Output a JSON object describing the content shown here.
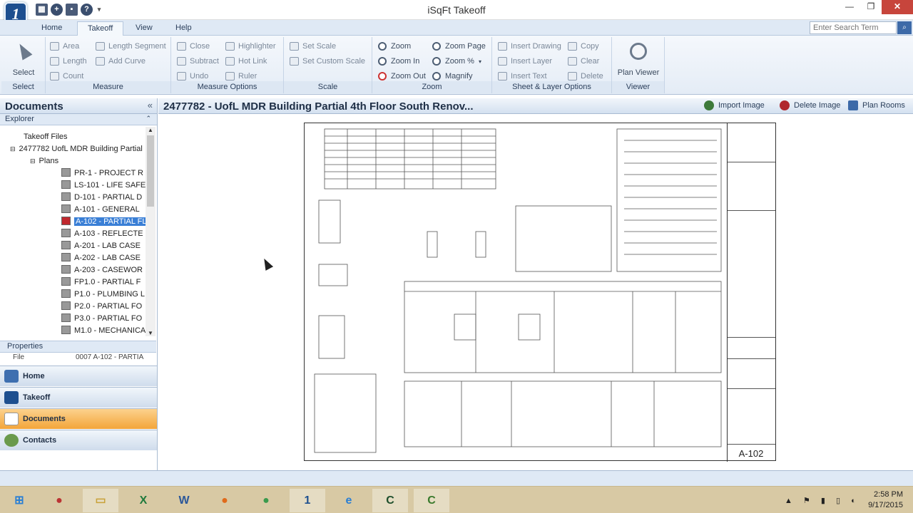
{
  "window": {
    "title": "iSqFt Takeoff",
    "logo": "1"
  },
  "ribbon_tabs": [
    "Home",
    "Takeoff",
    "View",
    "Help"
  ],
  "search": {
    "placeholder": "Enter Search Term"
  },
  "ribbon": {
    "select": {
      "label": "Select",
      "group": "Select"
    },
    "measure": {
      "group": "Measure",
      "area": "Area",
      "length": "Length",
      "count": "Count",
      "length_segment": "Length Segment",
      "add_curve": "Add Curve"
    },
    "measure_options": {
      "group": "Measure Options",
      "close": "Close",
      "subtract": "Subtract",
      "undo": "Undo",
      "highlighter": "Highlighter",
      "hot_link": "Hot Link",
      "ruler": "Ruler"
    },
    "scale": {
      "group": "Scale",
      "set_scale": "Set Scale",
      "set_custom_scale": "Set Custom Scale"
    },
    "zoom": {
      "group": "Zoom",
      "zoom": "Zoom",
      "zoom_in": "Zoom In",
      "zoom_out": "Zoom Out",
      "zoom_page": "Zoom Page",
      "zoom_pct": "Zoom %",
      "magnify": "Magnify"
    },
    "sheet_layer": {
      "group": "Sheet & Layer Options",
      "insert_drawing": "Insert Drawing",
      "insert_layer": "Insert Layer",
      "insert_text": "Insert Text",
      "copy": "Copy",
      "clear": "Clear",
      "delete": "Delete"
    },
    "viewer": {
      "group": "Viewer",
      "plan_viewer": "Plan Viewer"
    }
  },
  "documents": {
    "title": "Documents",
    "explorer": "Explorer",
    "tree_root": "Takeoff Files",
    "project": "2477782 UofL MDR Building Partial",
    "folder": "Plans",
    "sheets": [
      "PR-1 - PROJECT R",
      "LS-101 - LIFE SAFE",
      "D-101 - PARTIAL D",
      "A-101 - GENERAL",
      "A-102 - PARTIAL FL",
      "A-103 - REFLECTE",
      "A-201 - LAB CASE",
      "A-202 - LAB CASE",
      "A-203 - CASEWOR",
      "FP1.0 - PARTIAL F",
      "P1.0 - PLUMBING L",
      "P2.0 - PARTIAL FO",
      "P3.0 - PARTIAL FO",
      "M1.0 - MECHANICA"
    ],
    "selected_index": 4,
    "properties": "Properties",
    "prop_key": "File",
    "prop_val": "0007 A-102 - PARTIA"
  },
  "nav": [
    "Home",
    "Takeoff",
    "Documents",
    "Contacts"
  ],
  "doc": {
    "title": "2477782 - UofL MDR Building Partial 4th Floor South Renov...",
    "import_image": "Import Image",
    "delete_image": "Delete Image",
    "plan_rooms": "Plan Rooms",
    "sheet_number": "A-102"
  },
  "taskbar": {
    "time": "2:58 PM",
    "date": "9/17/2015"
  }
}
